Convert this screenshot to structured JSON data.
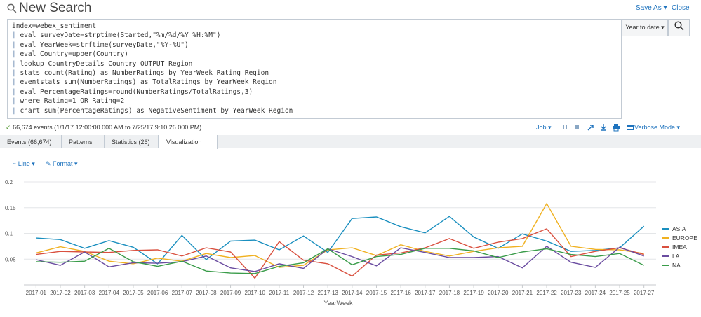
{
  "header": {
    "title": "New Search",
    "save_as": "Save As ▾",
    "close": "Close"
  },
  "query": {
    "lines": [
      "index=webex_sentiment",
      "| eval surveyDate=strptime(Started,\"%m/%d/%Y %H:%M\")",
      "| eval YearWeek=strftime(surveyDate,\"%Y-%U\")",
      "| eval Country=upper(Country)",
      "| lookup CountryDetails Country OUTPUT Region",
      "| stats count(Rating) as NumberRatings by YearWeek Rating Region",
      "| eventstats sum(NumberRatings) as TotalRatings by YearWeek Region",
      "| eval PercentageRatings=round(NumberRatings/TotalRatings,3)",
      "| where Rating=1 OR Rating=2",
      "| chart sum(PercentageRatings) as NegativeSentiment by YearWeek Region"
    ]
  },
  "time_picker": {
    "label": "Year to date ▾"
  },
  "status": {
    "check": "✓",
    "text": "66,674 events (1/1/17 12:00:00.000 AM to 7/25/17 9:10:26.000 PM)",
    "job": "Job ▾",
    "mode": "Verbose Mode ▾"
  },
  "tabs": [
    {
      "label": "Events (66,674)"
    },
    {
      "label": "Patterns"
    },
    {
      "label": "Statistics (26)"
    },
    {
      "label": "Visualization"
    }
  ],
  "viz_controls": {
    "chart_type": "Line ▾",
    "format": "Format ▾"
  },
  "colors": {
    "ASIA": "#1a8fbf",
    "EUROPE": "#f0b121",
    "IMEA": "#d9503f",
    "LA": "#6a4ca0",
    "NA": "#3a9c4a"
  },
  "chart_data": {
    "type": "line",
    "title": "",
    "xlabel": "YearWeek",
    "ylabel": "",
    "ylim": [
      0,
      0.2
    ],
    "yticks": [
      "0.05",
      "0.1",
      "0.15",
      "0.2"
    ],
    "grid": true,
    "legend": "right",
    "categories": [
      "2017-01",
      "2017-02",
      "2017-03",
      "2017-04",
      "2017-05",
      "2017-06",
      "2017-07",
      "2017-08",
      "2017-09",
      "2017-10",
      "2017-11",
      "2017-12",
      "2017-13",
      "2017-14",
      "2017-15",
      "2017-16",
      "2017-17",
      "2017-18",
      "2017-19",
      "2017-20",
      "2017-21",
      "2017-22",
      "2017-23",
      "2017-24",
      "2017-25",
      "2017-27"
    ],
    "series": [
      {
        "name": "ASIA",
        "values": [
          0.091,
          0.088,
          0.071,
          0.086,
          0.073,
          0.041,
          0.096,
          0.049,
          0.085,
          0.087,
          0.068,
          0.095,
          0.063,
          0.129,
          0.132,
          0.113,
          0.101,
          0.133,
          0.093,
          0.071,
          0.099,
          0.085,
          0.065,
          0.067,
          0.072,
          0.114
        ]
      },
      {
        "name": "EUROPE",
        "values": [
          0.062,
          0.074,
          0.065,
          0.046,
          0.041,
          0.052,
          0.046,
          0.061,
          0.053,
          0.057,
          0.034,
          0.038,
          0.068,
          0.072,
          0.057,
          0.078,
          0.065,
          0.056,
          0.065,
          0.072,
          0.075,
          0.158,
          0.075,
          0.069,
          0.068,
          0.061
        ]
      },
      {
        "name": "IMEA",
        "values": [
          0.059,
          0.065,
          0.064,
          0.063,
          0.067,
          0.068,
          0.056,
          0.072,
          0.064,
          0.013,
          0.084,
          0.048,
          0.041,
          0.017,
          0.058,
          0.062,
          0.072,
          0.09,
          0.071,
          0.083,
          0.09,
          0.109,
          0.055,
          0.065,
          0.072,
          0.059
        ]
      },
      {
        "name": "LA",
        "values": [
          0.049,
          0.038,
          0.064,
          0.035,
          0.043,
          0.042,
          0.045,
          0.056,
          0.033,
          0.026,
          0.041,
          0.032,
          0.07,
          0.055,
          0.037,
          0.072,
          0.063,
          0.053,
          0.053,
          0.055,
          0.033,
          0.075,
          0.044,
          0.034,
          0.073,
          0.056
        ]
      },
      {
        "name": "NA",
        "values": [
          0.045,
          0.044,
          0.046,
          0.071,
          0.045,
          0.036,
          0.046,
          0.027,
          0.023,
          0.022,
          0.036,
          0.043,
          0.07,
          0.039,
          0.055,
          0.059,
          0.071,
          0.071,
          0.066,
          0.053,
          0.064,
          0.07,
          0.059,
          0.055,
          0.061,
          0.038
        ]
      }
    ]
  }
}
